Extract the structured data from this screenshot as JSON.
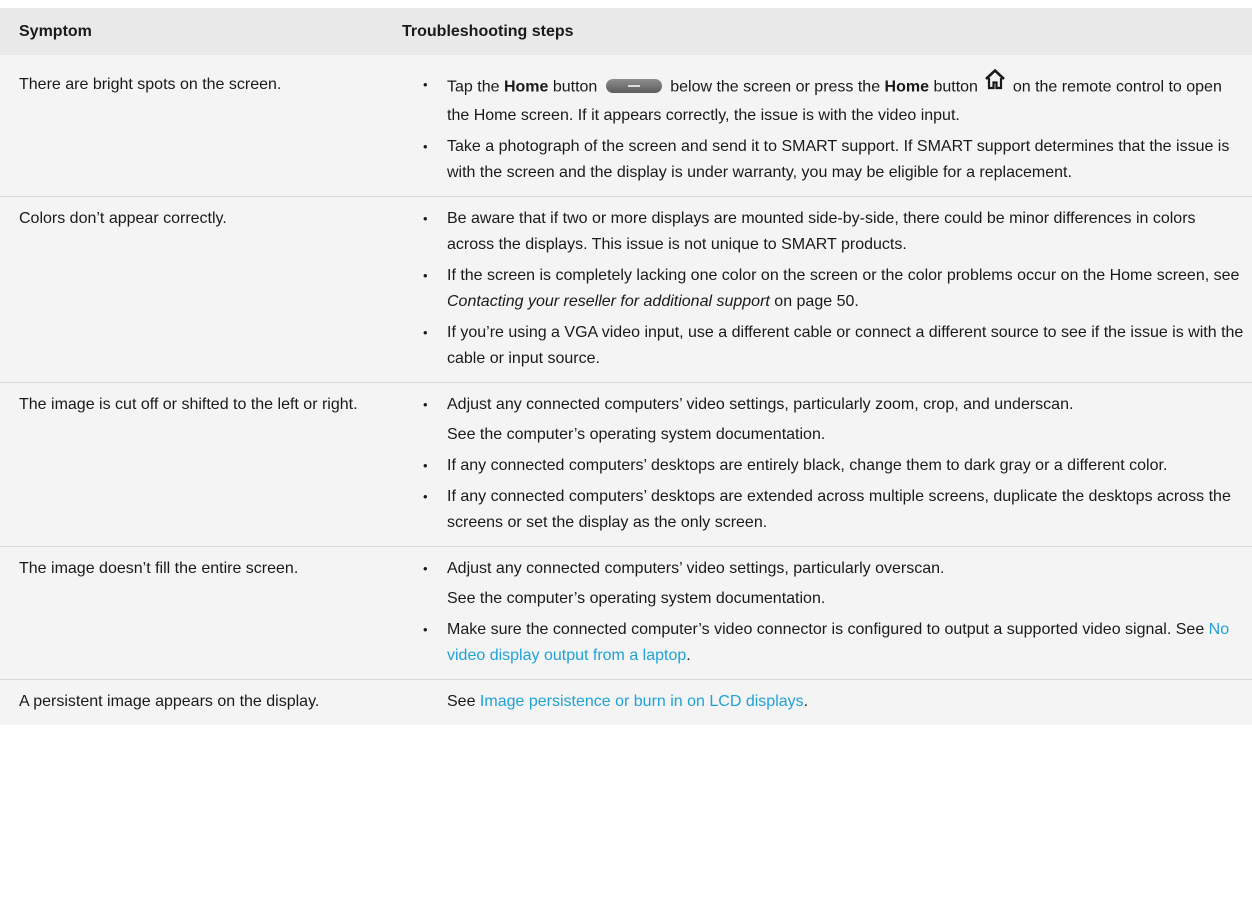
{
  "header": {
    "symptom": "Symptom",
    "steps": "Troubleshooting steps"
  },
  "icons": {
    "home_pill": "home-button-pill-icon",
    "home": "home-house-icon"
  },
  "colors": {
    "header_bg": "#e9e9e9",
    "row_bg": "#f4f4f4",
    "link": "#1fa2d6"
  },
  "rows": [
    {
      "symptom": "There are bright spots on the screen.",
      "b1": {
        "t1": "Tap the ",
        "home1": "Home",
        "t2": " button ",
        "t3": " below the screen or press the ",
        "home2": "Home",
        "t4": " button ",
        "t5": " on the remote control to open the Home screen. If it appears correctly, the issue is with the video input."
      },
      "b2": "Take a photograph of the screen and send it to SMART support. If SMART support determines that the issue is with the screen and the display is under warranty, you may be eligible for a replacement."
    },
    {
      "symptom": "Colors don’t appear correctly.",
      "b1": "Be aware that if two or more displays are mounted side-by-side, there could be minor differences in colors across the displays. This issue is not unique to SMART products.",
      "b2": {
        "t1": "If the screen is completely lacking one color on the screen or the color problems occur on the Home screen, see ",
        "ref": "Contacting your reseller for additional support",
        "t2": " on page 50."
      },
      "b3": "If you’re using a VGA video input, use a different cable or connect a different source to see if the issue is with the cable or input source."
    },
    {
      "symptom": "The image is cut off or shifted to the left or right.",
      "b1": "Adjust any connected computers’ video settings, particularly zoom, crop, and underscan.",
      "b1_sub": "See the computer’s operating system documentation.",
      "b2": "If any connected computers’ desktops are entirely black, change them to dark gray or a different color.",
      "b3": "If any connected computers’ desktops are extended across multiple screens, duplicate the desktops across the screens or set the display as the only screen."
    },
    {
      "symptom": "The image doesn’t fill the entire screen.",
      "b1": "Adjust any connected computers’ video settings, particularly overscan.",
      "b1_sub": "See the computer’s operating system documentation.",
      "b2": {
        "t1": "Make sure the connected computer’s video connector is configured to output a supported video signal. See ",
        "link": "No video display output from a laptop",
        "t2": "."
      }
    },
    {
      "symptom": "A persistent image appears on the display.",
      "see": {
        "t1": "See ",
        "link": "Image persistence or burn in on LCD displays",
        "t2": "."
      }
    }
  ]
}
